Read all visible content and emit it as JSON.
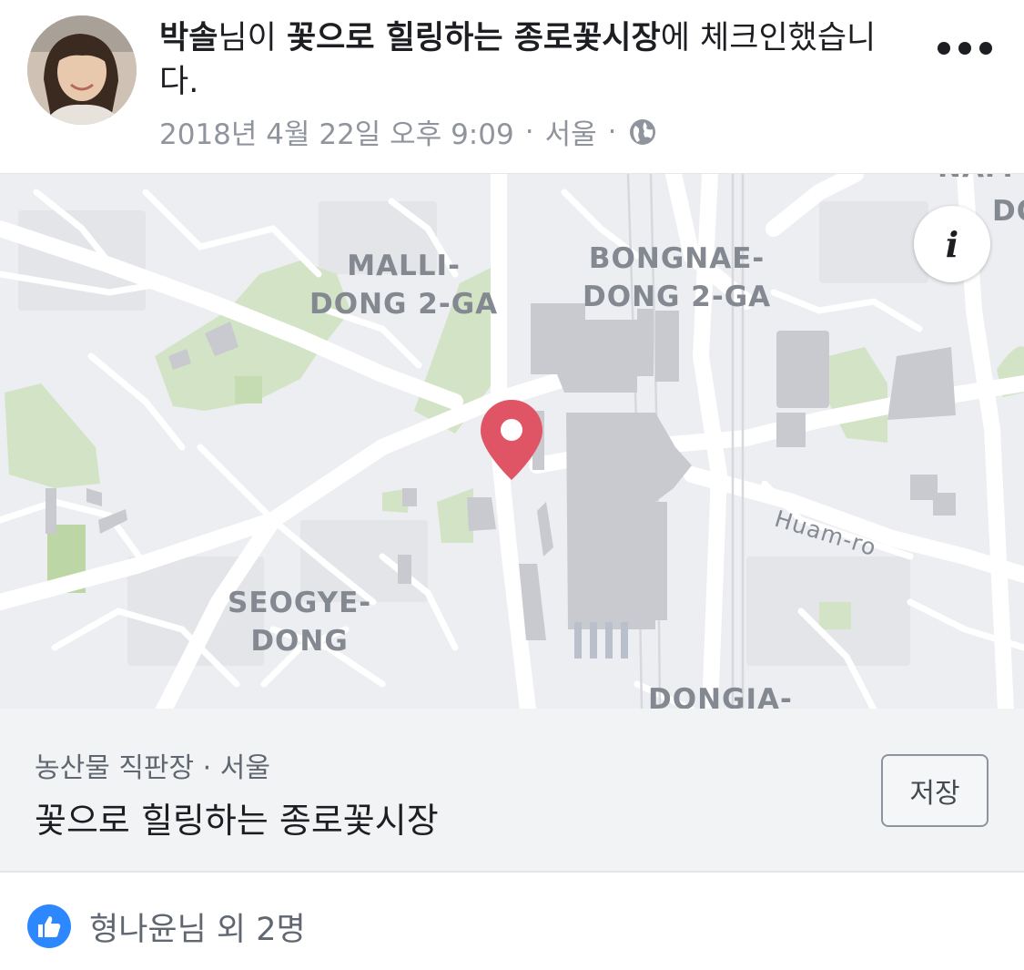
{
  "post": {
    "author": "박솔",
    "headline_mid": "님이 ",
    "place_link": "꽃으로 힐링하는 종로꽃시장",
    "headline_suffix": "에 체크인했습니다.",
    "timestamp": "2018년 4월 22일 오후 9:09",
    "separator": "·",
    "location": "서울",
    "privacy_icon": "globe-icon",
    "more_icon": "more-options-icon"
  },
  "map": {
    "labels": {
      "malli": "MALLI-\nDONG 2-GA",
      "bongnae": "BONGNAE-\nDONG 2-GA",
      "seogye": "SEOGYE-\nDONG",
      "dongja": "DONGJA-",
      "huam": "Huam-ro",
      "edge_nam": "NAM",
      "edge_do": "DO"
    },
    "info_icon": "i",
    "pin_color": "#e05566"
  },
  "place": {
    "category": "농산물 직판장 · 서울",
    "name": "꽃으로 힐링하는 종로꽃시장",
    "save_label": "저장"
  },
  "reactions": {
    "icon": "like-icon",
    "text": "형나윤님 외 2명",
    "accent": "#2d88ff"
  }
}
